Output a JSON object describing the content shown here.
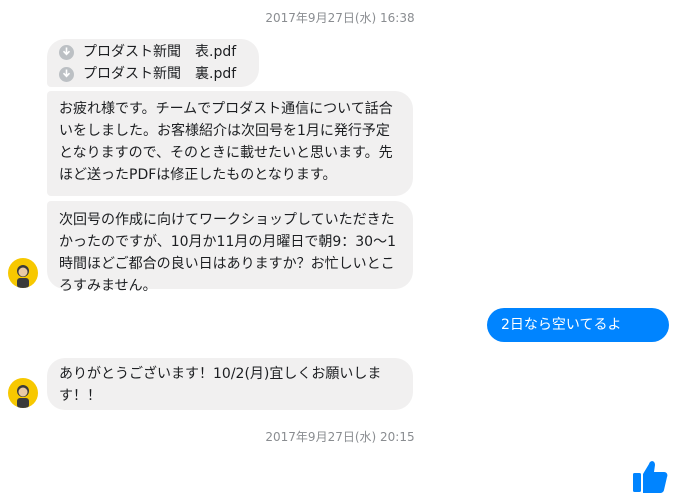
{
  "timestamps": {
    "first": "2017年9月27日(水) 16:38",
    "second": "2017年9月27日(水) 20:15"
  },
  "attachments": [
    {
      "name": "プロダスト新聞　表.pdf",
      "icon": "download-icon"
    },
    {
      "name": "プロダスト新聞　裏.pdf",
      "icon": "download-icon"
    }
  ],
  "messages": {
    "incoming_1": "お疲れ様です。チームでプロダスト通信について話合いをしました。お客様紹介は次回号を1月に発行予定となりますので、そのときに載せたいと思います。先ほど送ったPDFは修正したものとなります。",
    "incoming_2": "次回号の作成に向けてワークショップしていただきたかったのですが、10月か11月の月曜日で朝9：30〜1時間ほどご都合の良い日はありますか？お忙しいところすみません。",
    "outgoing_1": "2日なら空いてるよ(^^)",
    "incoming_3": "ありがとうございます！10/2(月)宜しくお願いします！！"
  },
  "colors": {
    "incoming_bubble": "#f1f0f0",
    "outgoing_bubble": "#0084ff",
    "avatar_bg": "#f7c800",
    "like": "#0084ff"
  }
}
